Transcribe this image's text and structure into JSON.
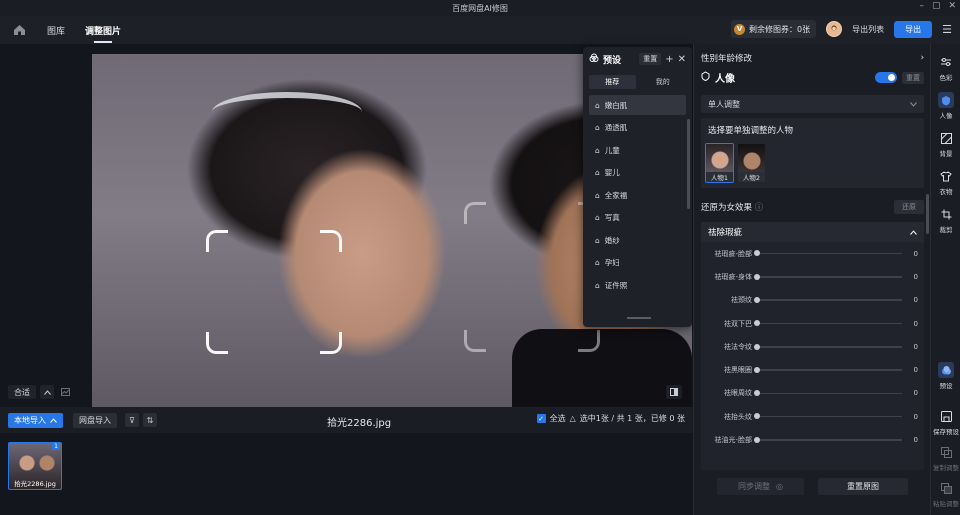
{
  "window": {
    "title": "百度网盘AI修图"
  },
  "topbar": {
    "tabs": [
      "图库",
      "调整图片"
    ],
    "active_tab": 1,
    "quota_icon": "V",
    "quota_text": "剩余修图券：0张",
    "export_list": "导出列表",
    "export": "导出"
  },
  "canvas": {
    "fit_label": "合适"
  },
  "preset": {
    "title": "预设",
    "reset": "重置",
    "tabs": [
      "推荐",
      "我的"
    ],
    "items": [
      "嫩白肌",
      "通透肌",
      "儿童",
      "婴儿",
      "全家福",
      "写真",
      "婚纱",
      "孕妇",
      "证件照"
    ]
  },
  "bottom": {
    "local_import": "本地导入",
    "cloud_import": "网盘导入",
    "file_name": "拾光2286.jpg",
    "select_all": "全选",
    "status": "选中1张 / 共 1 张，已修 0 张",
    "thumb_label": "拾光2286.jpg",
    "thumb_num": "1"
  },
  "panel": {
    "title": "性别年龄修改",
    "person_label": "人像",
    "reset_mini": "重置",
    "mode": "单人调整",
    "choose_title": "选择要单独调整的人物",
    "faces": [
      "人物1",
      "人物2"
    ],
    "restore_label": "还原为女效果",
    "restore_btn": "还原",
    "section": "祛除瑕疵",
    "sliders": [
      {
        "label": "祛瑕疵-脸部",
        "value": "0"
      },
      {
        "label": "祛瑕疵-身体",
        "value": "0"
      },
      {
        "label": "祛颈纹",
        "value": "0"
      },
      {
        "label": "祛双下巴",
        "value": "0"
      },
      {
        "label": "祛法令纹",
        "value": "0"
      },
      {
        "label": "祛黑眼圈",
        "value": "0"
      },
      {
        "label": "祛眼周纹",
        "value": "0"
      },
      {
        "label": "祛抬头纹",
        "value": "0"
      },
      {
        "label": "祛油光-脸部",
        "value": "0"
      }
    ],
    "sync": "同步调整",
    "reset_original": "重置原图"
  },
  "rail": {
    "items": [
      "色彩",
      "人像",
      "背景",
      "衣物",
      "裁剪"
    ],
    "bottom": [
      "预设",
      "保存预设",
      "复制调整",
      "粘贴调整"
    ]
  },
  "colors": {
    "accent": "#2877e8",
    "background": "#14161d"
  }
}
